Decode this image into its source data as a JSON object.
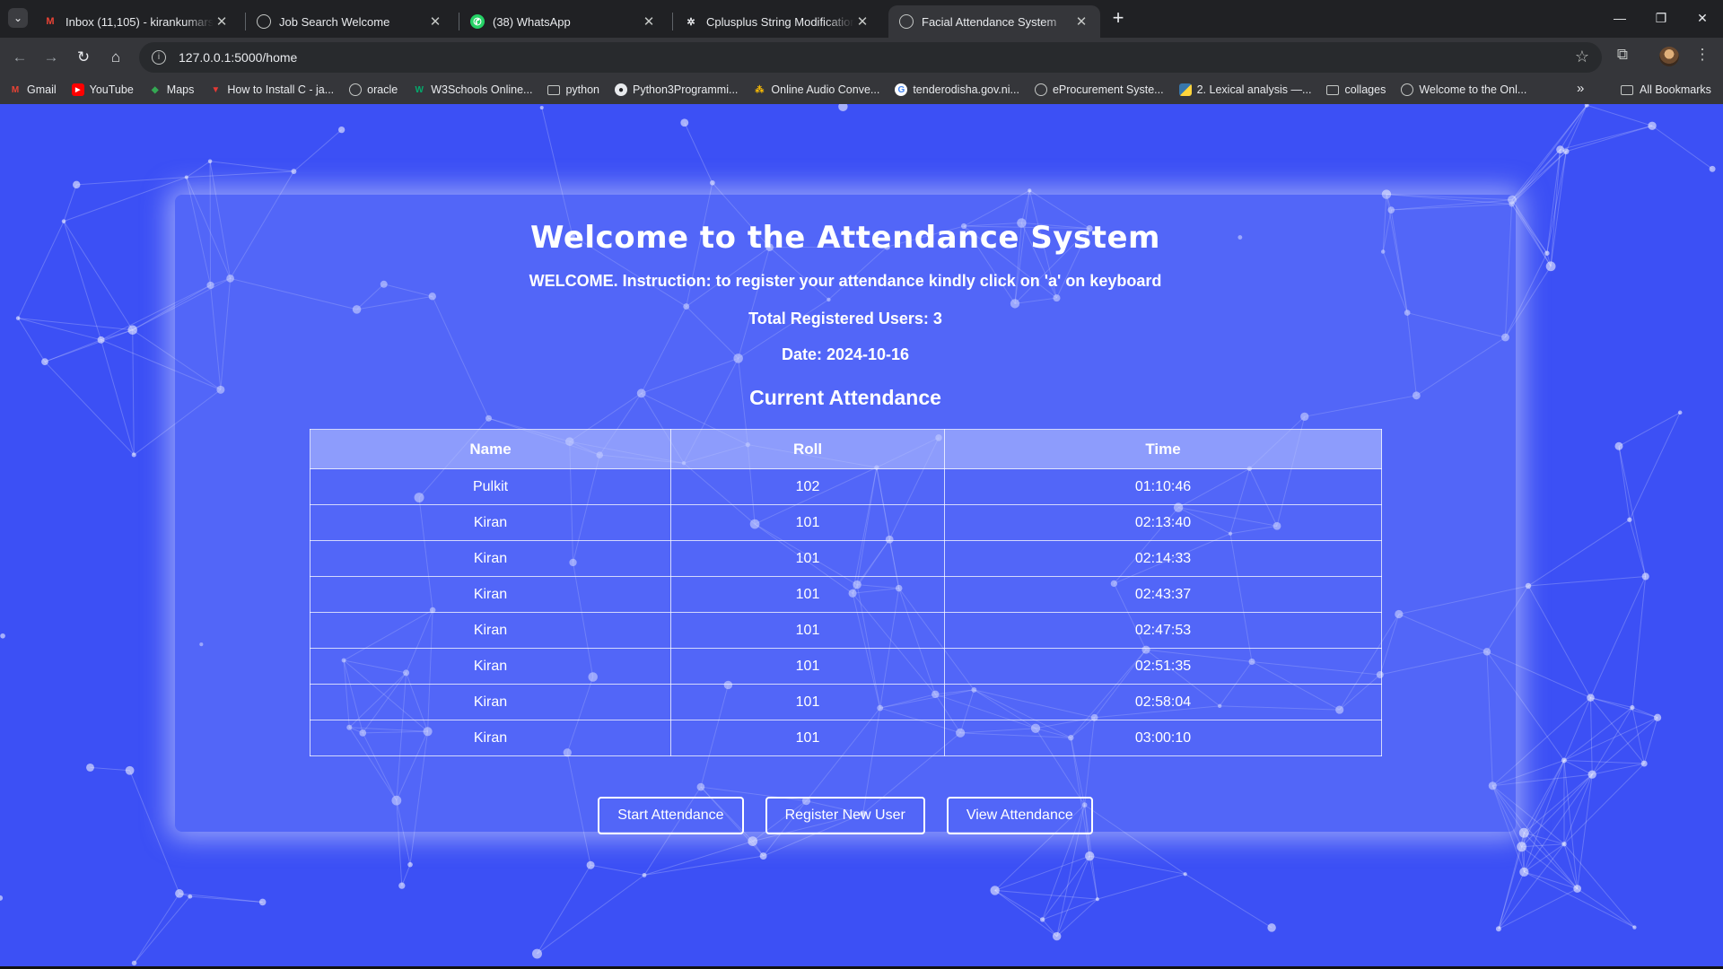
{
  "browser": {
    "tabs": [
      {
        "title": "Inbox (11,105) - kirankumarsahu",
        "icon": "gmail-icon",
        "active": false
      },
      {
        "title": "Job Search Welcome",
        "icon": "globe-icon",
        "active": false
      },
      {
        "title": "(38) WhatsApp",
        "icon": "whatsapp-icon",
        "active": false
      },
      {
        "title": "Cplusplus String Modification F",
        "icon": "openai-icon",
        "active": false
      },
      {
        "title": "Facial Attendance System",
        "icon": "globe-icon",
        "active": true
      }
    ],
    "url": "127.0.0.1:5000/home",
    "bookmarks": [
      {
        "label": "Gmail",
        "icon": "gmail-icon"
      },
      {
        "label": "YouTube",
        "icon": "youtube-icon"
      },
      {
        "label": "Maps",
        "icon": "maps-icon"
      },
      {
        "label": "How to Install C - ja...",
        "icon": "v-icon"
      },
      {
        "label": "oracle",
        "icon": "globe-icon"
      },
      {
        "label": "W3Schools Online...",
        "icon": "w3schools-icon"
      },
      {
        "label": "python",
        "icon": "folder-icon"
      },
      {
        "label": "Python3Programmi...",
        "icon": "github-icon"
      },
      {
        "label": "Online Audio Conve...",
        "icon": "audio-icon"
      },
      {
        "label": "tenderodisha.gov.ni...",
        "icon": "google-icon"
      },
      {
        "label": "eProcurement Syste...",
        "icon": "globe-icon"
      },
      {
        "label": "2. Lexical analysis —...",
        "icon": "python-icon"
      },
      {
        "label": "collages",
        "icon": "folder-icon"
      },
      {
        "label": "Welcome to the Onl...",
        "icon": "globe-icon"
      }
    ],
    "all_bookmarks_label": "All Bookmarks"
  },
  "page": {
    "title": "Welcome to the Attendance System",
    "instruction": "WELCOME. Instruction: to register your attendance kindly click on 'a' on keyboard",
    "total_users": "Total Registered Users: 3",
    "date": "Date: 2024-10-16",
    "subtitle": "Current Attendance",
    "table": {
      "headers": [
        "Name",
        "Roll",
        "Time"
      ],
      "rows": [
        [
          "Pulkit",
          "102",
          "01:10:46"
        ],
        [
          "Kiran",
          "101",
          "02:13:40"
        ],
        [
          "Kiran",
          "101",
          "02:14:33"
        ],
        [
          "Kiran",
          "101",
          "02:43:37"
        ],
        [
          "Kiran",
          "101",
          "02:47:53"
        ],
        [
          "Kiran",
          "101",
          "02:51:35"
        ],
        [
          "Kiran",
          "101",
          "02:58:04"
        ],
        [
          "Kiran",
          "101",
          "03:00:10"
        ]
      ]
    },
    "buttons": {
      "start": "Start Attendance",
      "register": "Register New User",
      "view": "View Attendance"
    },
    "colors": {
      "background": "#3c50f5",
      "text": "#ffffff"
    }
  }
}
